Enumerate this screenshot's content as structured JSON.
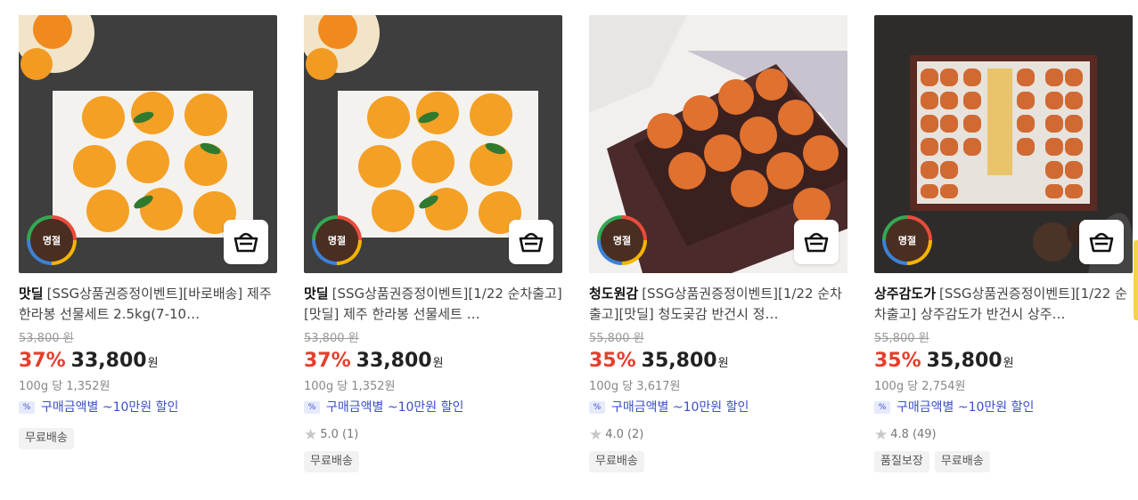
{
  "cart_icon": "basket-icon",
  "badge_icon": "meistro-badge",
  "coupon_icon": "discount-percent-icon",
  "products": [
    {
      "badge": "명절",
      "brand": "맛딜",
      "title": "[SSG상품권증정이벤트][바로배송] 제주 한라봉 선물세트 2.5kg(7-10…",
      "original_price": "53,800 원",
      "discount_rate": "37%",
      "price": "33,800",
      "currency": "원",
      "unit_price": "100g 당 1,352원",
      "coupon": "구매금액별 ~10만원 할인",
      "rating": "",
      "reviews": "",
      "tags": [
        "무료배송"
      ]
    },
    {
      "badge": "명절",
      "brand": "맛딜",
      "title": "[SSG상품권증정이벤트][1/22 순차출고][맛딜] 제주 한라봉 선물세트 …",
      "original_price": "53,800 원",
      "discount_rate": "37%",
      "price": "33,800",
      "currency": "원",
      "unit_price": "100g 당 1,352원",
      "coupon": "구매금액별 ~10만원 할인",
      "rating": "5.0",
      "reviews": "(1)",
      "tags": [
        "무료배송"
      ]
    },
    {
      "badge": "명절",
      "brand": "청도원감",
      "title": "[SSG상품권증정이벤트][1/22 순차출고][맛딜] 청도곶감 반건시 정…",
      "original_price": "55,800 원",
      "discount_rate": "35%",
      "price": "35,800",
      "currency": "원",
      "unit_price": "100g 당 3,617원",
      "coupon": "구매금액별 ~10만원 할인",
      "rating": "4.0",
      "reviews": "(2)",
      "tags": [
        "무료배송"
      ]
    },
    {
      "badge": "명절",
      "brand": "상주감도가",
      "title": "[SSG상품권증정이벤트][1/22 순차출고] 상주감도가 반건시 상주…",
      "original_price": "55,800 원",
      "discount_rate": "35%",
      "price": "35,800",
      "currency": "원",
      "unit_price": "100g 당 2,754원",
      "coupon": "구매금액별 ~10만원 할인",
      "rating": "4.8",
      "reviews": "(49)",
      "tags": [
        "품질보장",
        "무료배송"
      ]
    }
  ],
  "colors": {
    "discount": "#e53e2c",
    "coupon": "#3b4ec9",
    "badge_bg": "#4a2e22"
  }
}
